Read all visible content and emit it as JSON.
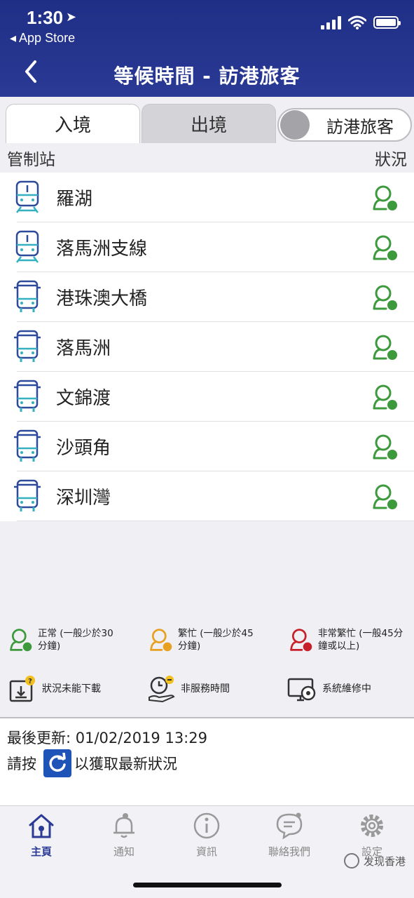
{
  "status_bar": {
    "time": "1:30",
    "location_glyph": "➤",
    "back_app": "◂ App Store"
  },
  "header": {
    "title": "等候時間 - 訪港旅客"
  },
  "tabs": {
    "entry": "入境",
    "exit": "出境",
    "toggle_label": "訪港旅客"
  },
  "columns": {
    "station": "管制站",
    "status": "狀況"
  },
  "stations": [
    {
      "name": "羅湖",
      "type": "train"
    },
    {
      "name": "落馬洲支線",
      "type": "train"
    },
    {
      "name": "港珠澳大橋",
      "type": "bus"
    },
    {
      "name": "落馬洲",
      "type": "bus"
    },
    {
      "name": "文錦渡",
      "type": "bus"
    },
    {
      "name": "沙頭角",
      "type": "bus"
    },
    {
      "name": "深圳灣",
      "type": "bus"
    }
  ],
  "colors": {
    "normal": "#3c9a3c",
    "busy": "#e8a020",
    "very_busy": "#c8202a",
    "header": "#24348c",
    "icon_blue": "#2e4a9a",
    "icon_teal": "#34b0c0"
  },
  "legend": {
    "normal_line1": "正常 (一般少於30",
    "normal_line2": "分鐘)",
    "busy_line1": "繁忙 (一般少於45",
    "busy_line2": "分鐘)",
    "very_busy_line1": "非常繁忙 (一般45分",
    "very_busy_line2": "鐘或以上)",
    "not_downloaded": "狀況未能下載",
    "non_service": "非服務時間",
    "maintenance": "系統維修中"
  },
  "update": {
    "last_update": "最後更新:  01/02/2019 13:29",
    "press": "請按",
    "refresh_hint": "以獲取最新狀況"
  },
  "nav": {
    "home": "主頁",
    "notify": "通知",
    "info": "資訊",
    "contact": "聯絡我們",
    "settings": "設定"
  },
  "watermark": "发现香港"
}
